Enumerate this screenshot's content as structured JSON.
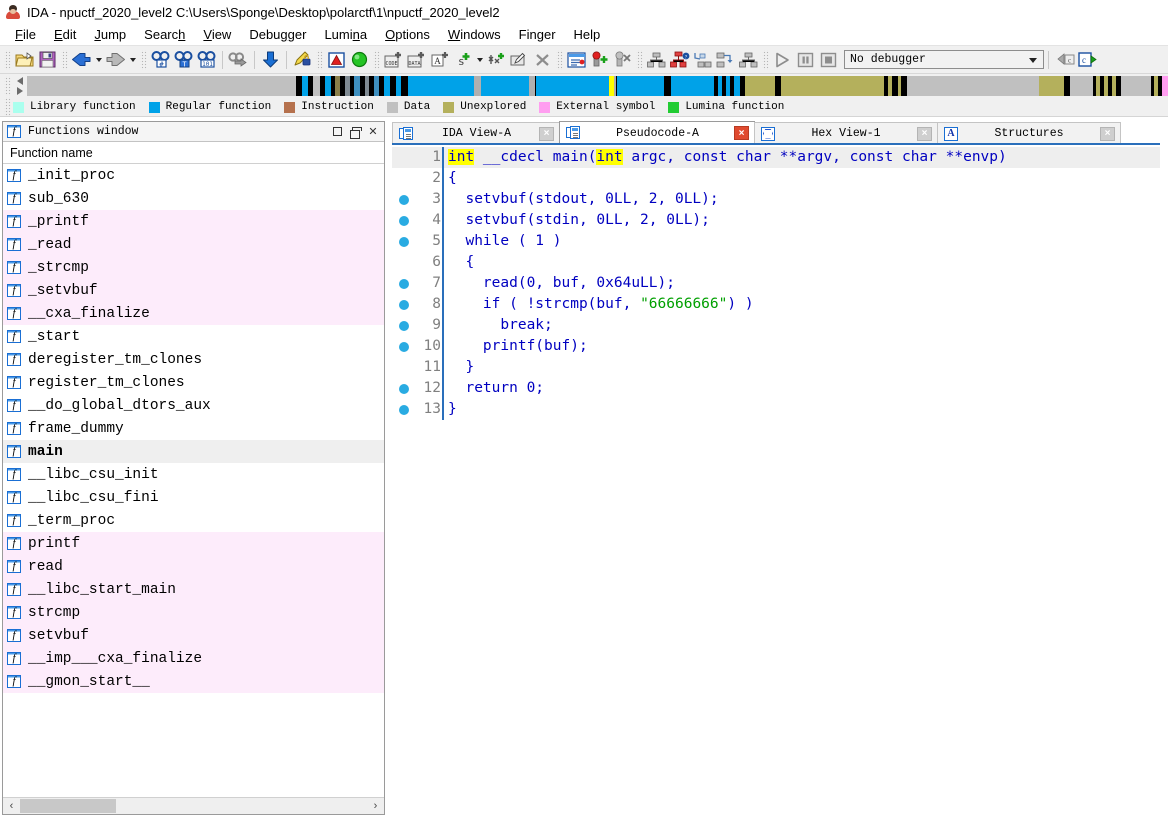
{
  "window": {
    "title": "IDA - npuctf_2020_level2 C:\\Users\\Sponge\\Desktop\\polarctf\\1\\npuctf_2020_level2",
    "app_icon": "ida-logo-icon"
  },
  "menubar": {
    "items": [
      {
        "label": "File",
        "accel": "F"
      },
      {
        "label": "Edit",
        "accel": "E"
      },
      {
        "label": "Jump",
        "accel": "J"
      },
      {
        "label": "Search",
        "accel": "h"
      },
      {
        "label": "View",
        "accel": "V"
      },
      {
        "label": "Debugger",
        "accel": "g"
      },
      {
        "label": "Lumina",
        "accel": "n"
      },
      {
        "label": "Options",
        "accel": "O"
      },
      {
        "label": "Windows",
        "accel": "W"
      },
      {
        "label": "Finger",
        "accel": ""
      },
      {
        "label": "Help",
        "accel": ""
      }
    ]
  },
  "toolbar": {
    "debugger_select_value": "No debugger",
    "groups": [
      {
        "name": "file",
        "buttons": [
          "open-file-icon",
          "save-icon"
        ]
      },
      {
        "name": "navigation",
        "buttons": [
          "back-arrow-icon",
          "back-dropdown-icon",
          "forward-arrow-icon",
          "forward-dropdown-icon"
        ]
      },
      {
        "name": "search",
        "buttons": [
          "search-sequence-icon",
          "search-text-icon",
          "search-immediate-icon",
          "search-next-icon",
          "jump-down-icon",
          "edit-highlight-icon"
        ]
      },
      {
        "name": "marks",
        "buttons": [
          "warning-icon",
          "green-circle-icon"
        ]
      },
      {
        "name": "make",
        "buttons": [
          "make-code-icon",
          "make-data-icon",
          "make-ascii-icon",
          "make-struct-icon",
          "make-struct-dropdown-icon",
          "make-array-icon",
          "rename-icon",
          "undefine-icon"
        ]
      },
      {
        "name": "breakpoints",
        "buttons": [
          "list-breakpoints-icon",
          "add-breakpoint-icon",
          "delete-breakpoint-icon"
        ]
      },
      {
        "name": "graphs",
        "buttons": [
          "flow-chart-icon",
          "call-graph-icon",
          "xrefs-from-icon",
          "xrefs-to-icon",
          "proximity-browser-icon"
        ]
      },
      {
        "name": "debug",
        "buttons": [
          "run-icon",
          "pause-icon",
          "stop-icon"
        ]
      },
      {
        "name": "decompile",
        "buttons": [
          "decompile-icon",
          "decompile-file-icon"
        ]
      }
    ]
  },
  "navband": {
    "cursor_position_pct": 51.0,
    "segments": [
      {
        "start_pct": 0.0,
        "width_pct": 23.6,
        "color": "#c0c0c0",
        "kind": "Data"
      },
      {
        "start_pct": 23.6,
        "width_pct": 0.5,
        "color": "#000000",
        "kind": "gap"
      },
      {
        "start_pct": 24.1,
        "width_pct": 0.5,
        "color": "#00a2e8",
        "kind": "Regular function"
      },
      {
        "start_pct": 24.6,
        "width_pct": 0.45,
        "color": "#000000",
        "kind": "gap"
      },
      {
        "start_pct": 25.1,
        "width_pct": 0.6,
        "color": "#c0c0c0",
        "kind": "Data"
      },
      {
        "start_pct": 25.7,
        "width_pct": 0.4,
        "color": "#000000",
        "kind": "gap"
      },
      {
        "start_pct": 26.1,
        "width_pct": 0.5,
        "color": "#00a2e8",
        "kind": "Regular function"
      },
      {
        "start_pct": 26.6,
        "width_pct": 0.4,
        "color": "#000000",
        "kind": "gap"
      },
      {
        "start_pct": 27.0,
        "width_pct": 0.45,
        "color": "#8a7f4a",
        "kind": "Instruction"
      },
      {
        "start_pct": 27.5,
        "width_pct": 0.35,
        "color": "#000000",
        "kind": "gap"
      },
      {
        "start_pct": 27.9,
        "width_pct": 0.45,
        "color": "#7f8a92",
        "kind": "Instruction"
      },
      {
        "start_pct": 28.3,
        "width_pct": 0.35,
        "color": "#000000",
        "kind": "gap"
      },
      {
        "start_pct": 28.7,
        "width_pct": 0.45,
        "color": "#3e8fbf",
        "kind": "Instruction"
      },
      {
        "start_pct": 29.2,
        "width_pct": 0.35,
        "color": "#000000",
        "kind": "gap"
      },
      {
        "start_pct": 29.6,
        "width_pct": 0.45,
        "color": "#7f8a92",
        "kind": "Instruction"
      },
      {
        "start_pct": 30.0,
        "width_pct": 0.35,
        "color": "#000000",
        "kind": "gap"
      },
      {
        "start_pct": 30.4,
        "width_pct": 0.45,
        "color": "#3e8fbf",
        "kind": "Instruction"
      },
      {
        "start_pct": 30.9,
        "width_pct": 0.4,
        "color": "#000000",
        "kind": "gap"
      },
      {
        "start_pct": 31.3,
        "width_pct": 0.5,
        "color": "#00a2e8",
        "kind": "Regular function"
      },
      {
        "start_pct": 31.8,
        "width_pct": 0.45,
        "color": "#000000",
        "kind": "gap"
      },
      {
        "start_pct": 32.3,
        "width_pct": 0.5,
        "color": "#00a2e8",
        "kind": "Regular function"
      },
      {
        "start_pct": 32.8,
        "width_pct": 0.55,
        "color": "#000000",
        "kind": "gap"
      },
      {
        "start_pct": 33.4,
        "width_pct": 5.8,
        "color": "#00a2e8",
        "kind": "Regular function"
      },
      {
        "start_pct": 39.2,
        "width_pct": 0.55,
        "color": "#b0b0b0",
        "kind": "Data"
      },
      {
        "start_pct": 39.8,
        "width_pct": 4.2,
        "color": "#00a2e8",
        "kind": "Regular function"
      },
      {
        "start_pct": 44.0,
        "width_pct": 0.55,
        "color": "#b0b0b0",
        "kind": "Data"
      },
      {
        "start_pct": 44.6,
        "width_pct": 6.6,
        "color": "#00a2e8",
        "kind": "Regular function"
      },
      {
        "start_pct": 51.2,
        "width_pct": 0.45,
        "color": "#b0b0b0",
        "kind": "Data"
      },
      {
        "start_pct": 51.7,
        "width_pct": 4.1,
        "color": "#00a2e8",
        "kind": "Regular function"
      },
      {
        "start_pct": 55.8,
        "width_pct": 0.6,
        "color": "#000000",
        "kind": "gap"
      },
      {
        "start_pct": 56.4,
        "width_pct": 3.8,
        "color": "#00a2e8",
        "kind": "Regular function"
      },
      {
        "start_pct": 60.2,
        "width_pct": 0.4,
        "color": "#000000",
        "kind": "gap"
      },
      {
        "start_pct": 60.6,
        "width_pct": 0.35,
        "color": "#00a2e8",
        "kind": "Regular function"
      },
      {
        "start_pct": 60.9,
        "width_pct": 0.35,
        "color": "#000000",
        "kind": "gap"
      },
      {
        "start_pct": 61.3,
        "width_pct": 0.35,
        "color": "#00a2e8",
        "kind": "Regular function"
      },
      {
        "start_pct": 61.6,
        "width_pct": 0.4,
        "color": "#000000",
        "kind": "gap"
      },
      {
        "start_pct": 62.0,
        "width_pct": 0.5,
        "color": "#00a2e8",
        "kind": "Regular function"
      },
      {
        "start_pct": 62.5,
        "width_pct": 0.4,
        "color": "#000000",
        "kind": "gap"
      },
      {
        "start_pct": 62.9,
        "width_pct": 2.7,
        "color": "#b4b05c",
        "kind": "Unexplored"
      },
      {
        "start_pct": 65.6,
        "width_pct": 0.45,
        "color": "#000000",
        "kind": "gap"
      },
      {
        "start_pct": 66.1,
        "width_pct": 9.0,
        "color": "#b4b05c",
        "kind": "Unexplored"
      },
      {
        "start_pct": 75.1,
        "width_pct": 0.4,
        "color": "#000000",
        "kind": "gap"
      },
      {
        "start_pct": 75.5,
        "width_pct": 0.35,
        "color": "#b4b05c",
        "kind": "Unexplored"
      },
      {
        "start_pct": 75.9,
        "width_pct": 0.4,
        "color": "#000000",
        "kind": "gap"
      },
      {
        "start_pct": 76.3,
        "width_pct": 0.35,
        "color": "#b4b05c",
        "kind": "Unexplored"
      },
      {
        "start_pct": 76.6,
        "width_pct": 0.45,
        "color": "#000000",
        "kind": "gap"
      },
      {
        "start_pct": 77.1,
        "width_pct": 11.6,
        "color": "#c0c0c0",
        "kind": "Data"
      },
      {
        "start_pct": 88.7,
        "width_pct": 2.2,
        "color": "#b4b05c",
        "kind": "Unexplored"
      },
      {
        "start_pct": 90.9,
        "width_pct": 0.45,
        "color": "#000000",
        "kind": "gap"
      },
      {
        "start_pct": 91.4,
        "width_pct": 2.0,
        "color": "#c0c0c0",
        "kind": "Data"
      },
      {
        "start_pct": 93.4,
        "width_pct": 0.35,
        "color": "#000000",
        "kind": "gap"
      },
      {
        "start_pct": 93.7,
        "width_pct": 0.35,
        "color": "#b4b05c",
        "kind": "Unexplored"
      },
      {
        "start_pct": 94.1,
        "width_pct": 0.35,
        "color": "#000000",
        "kind": "gap"
      },
      {
        "start_pct": 94.4,
        "width_pct": 0.35,
        "color": "#b4b05c",
        "kind": "Unexplored"
      },
      {
        "start_pct": 94.8,
        "width_pct": 0.35,
        "color": "#000000",
        "kind": "gap"
      },
      {
        "start_pct": 95.1,
        "width_pct": 0.35,
        "color": "#b4b05c",
        "kind": "Unexplored"
      },
      {
        "start_pct": 95.5,
        "width_pct": 0.4,
        "color": "#000000",
        "kind": "gap"
      },
      {
        "start_pct": 95.9,
        "width_pct": 2.6,
        "color": "#c0c0c0",
        "kind": "Data"
      },
      {
        "start_pct": 98.5,
        "width_pct": 0.35,
        "color": "#000000",
        "kind": "gap"
      },
      {
        "start_pct": 98.8,
        "width_pct": 0.35,
        "color": "#b4b05c",
        "kind": "Unexplored"
      },
      {
        "start_pct": 99.2,
        "width_pct": 0.35,
        "color": "#000000",
        "kind": "gap"
      },
      {
        "start_pct": 99.5,
        "width_pct": 0.5,
        "color": "#ff9ef0",
        "kind": "External symbol"
      }
    ]
  },
  "legend": {
    "items": [
      {
        "label": "Library function",
        "color": "#aaffee"
      },
      {
        "label": "Regular function",
        "color": "#00a2e8"
      },
      {
        "label": "Instruction",
        "color": "#b5714d"
      },
      {
        "label": "Data",
        "color": "#c0c0c0"
      },
      {
        "label": "Unexplored",
        "color": "#b4b05c"
      },
      {
        "label": "External symbol",
        "color": "#ff9ef0"
      },
      {
        "label": "Lumina function",
        "color": "#22cc33"
      }
    ]
  },
  "functions_window": {
    "title": "Functions window",
    "title_icon": "function-icon",
    "window_buttons": [
      "maximize-icon",
      "restore-icon",
      "close-icon"
    ],
    "column_header": "Function name",
    "rows": [
      {
        "name": "_init_proc",
        "library": false,
        "selected": false
      },
      {
        "name": "sub_630",
        "library": false,
        "selected": false
      },
      {
        "name": "_printf",
        "library": true,
        "selected": false
      },
      {
        "name": "_read",
        "library": true,
        "selected": false
      },
      {
        "name": "_strcmp",
        "library": true,
        "selected": false
      },
      {
        "name": "_setvbuf",
        "library": true,
        "selected": false
      },
      {
        "name": "__cxa_finalize",
        "library": true,
        "selected": false
      },
      {
        "name": "_start",
        "library": false,
        "selected": false
      },
      {
        "name": "deregister_tm_clones",
        "library": false,
        "selected": false
      },
      {
        "name": "register_tm_clones",
        "library": false,
        "selected": false
      },
      {
        "name": "__do_global_dtors_aux",
        "library": false,
        "selected": false
      },
      {
        "name": "frame_dummy",
        "library": false,
        "selected": false
      },
      {
        "name": "main",
        "library": false,
        "selected": true
      },
      {
        "name": "__libc_csu_init",
        "library": false,
        "selected": false
      },
      {
        "name": "__libc_csu_fini",
        "library": false,
        "selected": false
      },
      {
        "name": "_term_proc",
        "library": false,
        "selected": false
      },
      {
        "name": "printf",
        "library": true,
        "selected": false
      },
      {
        "name": "read",
        "library": true,
        "selected": false
      },
      {
        "name": "__libc_start_main",
        "library": true,
        "selected": false
      },
      {
        "name": "strcmp",
        "library": true,
        "selected": false
      },
      {
        "name": "setvbuf",
        "library": true,
        "selected": false
      },
      {
        "name": "__imp___cxa_finalize",
        "library": true,
        "selected": false
      },
      {
        "name": "__gmon_start__",
        "library": true,
        "selected": false
      }
    ],
    "hscroll": {
      "left_arrow": "‹",
      "right_arrow": "›"
    }
  },
  "tabs": [
    {
      "label": "IDA View-A",
      "icon": "ida-view-icon",
      "active": false,
      "close": "×"
    },
    {
      "label": "Pseudocode-A",
      "icon": "pseudocode-icon",
      "active": true,
      "close": "×"
    },
    {
      "label": "Hex View-1",
      "icon": "hex-view-icon",
      "active": false,
      "close": "×"
    },
    {
      "label": "Structures",
      "icon": "structures-icon",
      "active": false,
      "close": "×"
    }
  ],
  "pseudocode": {
    "lines": [
      {
        "num": "1",
        "dot": false,
        "current": true,
        "tokens": [
          {
            "t": "int",
            "c": "hl"
          },
          {
            "t": " __cdecl main(",
            "c": "kw"
          },
          {
            "t": "int",
            "c": "hl"
          },
          {
            "t": " argc, const char **argv, const char **envp)",
            "c": "kw"
          }
        ]
      },
      {
        "num": "2",
        "dot": false,
        "current": false,
        "tokens": [
          {
            "t": "{",
            "c": "kw"
          }
        ]
      },
      {
        "num": "3",
        "dot": true,
        "current": false,
        "tokens": [
          {
            "t": "  setvbuf(stdout, 0LL, 2, 0LL);",
            "c": "kw"
          }
        ]
      },
      {
        "num": "4",
        "dot": true,
        "current": false,
        "tokens": [
          {
            "t": "  setvbuf(stdin, 0LL, 2, 0LL);",
            "c": "kw"
          }
        ]
      },
      {
        "num": "5",
        "dot": true,
        "current": false,
        "tokens": [
          {
            "t": "  while ( 1 )",
            "c": "kw"
          }
        ]
      },
      {
        "num": "6",
        "dot": false,
        "current": false,
        "tokens": [
          {
            "t": "  {",
            "c": "kw"
          }
        ]
      },
      {
        "num": "7",
        "dot": true,
        "current": false,
        "tokens": [
          {
            "t": "    read(0, buf, 0x64uLL);",
            "c": "kw"
          }
        ]
      },
      {
        "num": "8",
        "dot": true,
        "current": false,
        "tokens": [
          {
            "t": "    if ( !strcmp(buf, ",
            "c": "kw"
          },
          {
            "t": "\"66666666\"",
            "c": "str"
          },
          {
            "t": ") )",
            "c": "kw"
          }
        ]
      },
      {
        "num": "9",
        "dot": true,
        "current": false,
        "tokens": [
          {
            "t": "      break;",
            "c": "kw"
          }
        ]
      },
      {
        "num": "10",
        "dot": true,
        "current": false,
        "tokens": [
          {
            "t": "    printf(buf);",
            "c": "kw"
          }
        ]
      },
      {
        "num": "11",
        "dot": false,
        "current": false,
        "tokens": [
          {
            "t": "  }",
            "c": "kw"
          }
        ]
      },
      {
        "num": "12",
        "dot": true,
        "current": false,
        "tokens": [
          {
            "t": "  return 0;",
            "c": "kw"
          }
        ]
      },
      {
        "num": "13",
        "dot": true,
        "current": false,
        "tokens": [
          {
            "t": "}",
            "c": "kw"
          }
        ]
      }
    ]
  }
}
